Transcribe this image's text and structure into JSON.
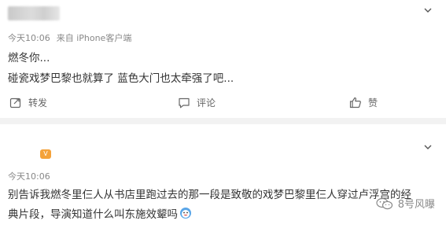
{
  "post1": {
    "time": "今天10:06",
    "source": "来自 iPhone客户端",
    "lines": [
      "燃冬你...",
      "碰瓷戏梦巴黎也就算了 蓝色大门也太牵强了吧..."
    ],
    "actions": {
      "repost": "转发",
      "comment": "评论",
      "like": "赞"
    }
  },
  "post2": {
    "vip_badge": "V",
    "time": "今天10:06",
    "lines": [
      "别告诉我燃冬里仨人从书店里跑过去的那一段是致敬的戏梦巴黎里仨人穿过卢浮宫的经",
      "典片段，导演知道什么叫东施效颦吗"
    ],
    "emoji": "grinning-face"
  },
  "watermark": {
    "text": "8号风曝"
  },
  "colors": {
    "gap": "#f2f2f2",
    "meta": "#888888",
    "text": "#333333",
    "vip": "#f4a23a"
  }
}
